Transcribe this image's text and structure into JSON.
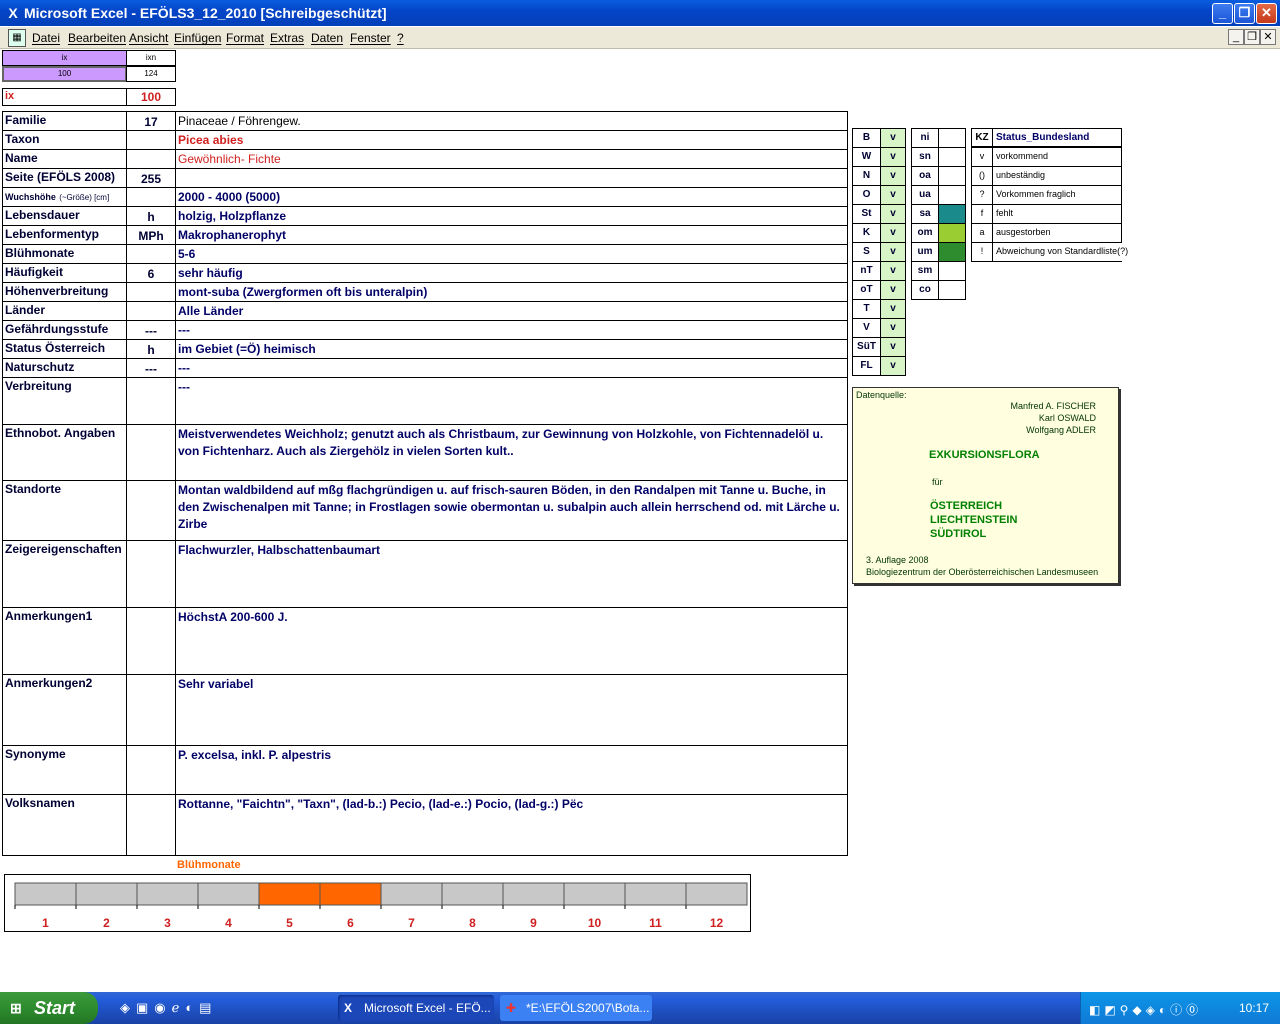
{
  "window": {
    "title": "Microsoft Excel - EFÖLS3_12_2010  [Schreibgeschützt]"
  },
  "menu": {
    "items": [
      "Datei",
      "Bearbeiten",
      "Ansicht",
      "Einfügen",
      "Format",
      "Extras",
      "Daten",
      "Fenster",
      "?"
    ]
  },
  "topcells": {
    "ix_hdr": "ix",
    "ixn_hdr": "ixn",
    "ix_val": "100",
    "ixn_val": "124",
    "ix_label": "ix",
    "ix_value": "100"
  },
  "rows": [
    {
      "label": "Familie",
      "code": "17",
      "value": "Pinaceae  /  Föhrengew."
    },
    {
      "label": "Taxon",
      "code": "",
      "value": "Picea abies"
    },
    {
      "label": "Name",
      "code": "",
      "value": "Gewöhnlich- Fichte"
    },
    {
      "label": "Seite (EFÖLS 2008)",
      "code": "255",
      "value": ""
    },
    {
      "label": "Wuchshöhe",
      "label_suffix": "(~Größe) [cm]",
      "code": "",
      "value": " 2000 - 4000 (5000)"
    },
    {
      "label": "Lebensdauer",
      "code": "h",
      "value": "holzig, Holzpflanze"
    },
    {
      "label": "Lebenformentyp",
      "code": "MPh",
      "value": "Makrophanerophyt"
    },
    {
      "label": "Blühmonate",
      "code": "",
      "value": " 5-6"
    },
    {
      "label": "Häufigkeit",
      "code": "6",
      "value": "sehr häufig"
    },
    {
      "label": "Höhenverbreitung",
      "code": "",
      "value": "mont-suba (Zwergformen oft bis unteralpin)"
    },
    {
      "label": "Länder",
      "code": "",
      "value": "Alle Länder"
    },
    {
      "label": "Gefährdungsstufe",
      "code": "---",
      "value": "  ---"
    },
    {
      "label": "Status Österreich",
      "code": "h",
      "value": "im Gebiet (=Ö) heimisch"
    },
    {
      "label": "Naturschutz",
      "code": "---",
      "value": " ---"
    },
    {
      "label": "Verbreitung",
      "code": "",
      "value": " ---"
    },
    {
      "label": "Ethnobot. Angaben",
      "code": "",
      "value": "Meistverwendetes Weichholz; genutzt auch als Christbaum, zur Gewinnung von Holzkohle, von Fichtennadelöl u. von Fichtenharz. Auch als Ziergehölz in vielen Sorten kult.."
    },
    {
      "label": "Standorte",
      "code": "",
      "value": "Montan waldbildend auf mßg flachgründigen u. auf frisch-sauren Böden, in den Randalpen mit Tanne u. Buche, in den Zwischenalpen mit Tanne; in Frostlagen sowie obermontan u. subalpin auch allein herrschend od. mit Lärche u. Zirbe"
    },
    {
      "label": "Zeigereigenschaften",
      "code": "",
      "value": "Flachwurzler, Halbschattenbaumart"
    },
    {
      "label": "Anmerkungen1",
      "code": "",
      "value": "HöchstA 200-600 J."
    },
    {
      "label": "Anmerkungen2",
      "code": "",
      "value": "Sehr variabel"
    },
    {
      "label": "Synonyme",
      "code": "",
      "value": "P. excelsa, inkl. P. alpestris"
    },
    {
      "label": "Volksnamen",
      "code": "",
      "value": "Rottanne, \"Faichtn\", \"Taxn\",  (lad-b.:) Pecio, (lad-e.:) Pocio, (lad-g.:) Pëc"
    }
  ],
  "regions": [
    {
      "code": "B",
      "v": "v"
    },
    {
      "code": "W",
      "v": "v"
    },
    {
      "code": "N",
      "v": "v"
    },
    {
      "code": "O",
      "v": "v"
    },
    {
      "code": "St",
      "v": "v"
    },
    {
      "code": "K",
      "v": "v"
    },
    {
      "code": "S",
      "v": "v"
    },
    {
      "code": "nT",
      "v": "v"
    },
    {
      "code": "oT",
      "v": "v"
    },
    {
      "code": "T",
      "v": "v"
    },
    {
      "code": "V",
      "v": "v"
    },
    {
      "code": "SüT",
      "v": "v"
    },
    {
      "code": "FL",
      "v": "v"
    }
  ],
  "zones": [
    {
      "code": "ni",
      "color": ""
    },
    {
      "code": "sn",
      "color": ""
    },
    {
      "code": "oa",
      "color": ""
    },
    {
      "code": "ua",
      "color": ""
    },
    {
      "code": "sa",
      "color": "#1a8a8a"
    },
    {
      "code": "om",
      "color": "#9acd32"
    },
    {
      "code": "um",
      "color": "#2e8b2e"
    },
    {
      "code": "sm",
      "color": ""
    },
    {
      "code": "co",
      "color": ""
    }
  ],
  "status": {
    "header_kz": "KZ",
    "header_label": "Status_Bundesland",
    "items": [
      {
        "kz": "v",
        "text": "vorkommend"
      },
      {
        "kz": "()",
        "text": "unbeständig"
      },
      {
        "kz": "?",
        "text": "Vorkommen fraglich"
      },
      {
        "kz": "f",
        "text": "fehlt"
      },
      {
        "kz": "a",
        "text": "ausgestorben"
      },
      {
        "kz": "!",
        "text": "Abweichung von Standardliste(?)"
      }
    ]
  },
  "source": {
    "label": "Datenquelle:",
    "authors": [
      "Manfred A. FISCHER",
      "Karl OSWALD",
      "Wolfgang ADLER"
    ],
    "title": "EXKURSIONSFLORA",
    "fuer": "für",
    "countries": [
      "ÖSTERREICH",
      "LIECHTENSTEIN",
      "SÜDTIROL"
    ],
    "edition": "3. Auflage 2008",
    "publisher": "Biologiezentrum der Oberösterreichischen Landesmuseen"
  },
  "chart_data": {
    "type": "bar",
    "title": "Blühmonate",
    "categories": [
      "1",
      "2",
      "3",
      "4",
      "5",
      "6",
      "7",
      "8",
      "9",
      "10",
      "11",
      "12"
    ],
    "values": [
      0,
      0,
      0,
      0,
      1,
      1,
      0,
      0,
      0,
      0,
      0,
      0
    ],
    "colors": {
      "active": "#ff6600",
      "inactive": "#c8c8c8"
    }
  },
  "taskbar": {
    "start": "Start",
    "tasks": [
      "Microsoft Excel - EFÖ...",
      "*E:\\EFÖLS2007\\Bota..."
    ],
    "clock": "10:17"
  }
}
